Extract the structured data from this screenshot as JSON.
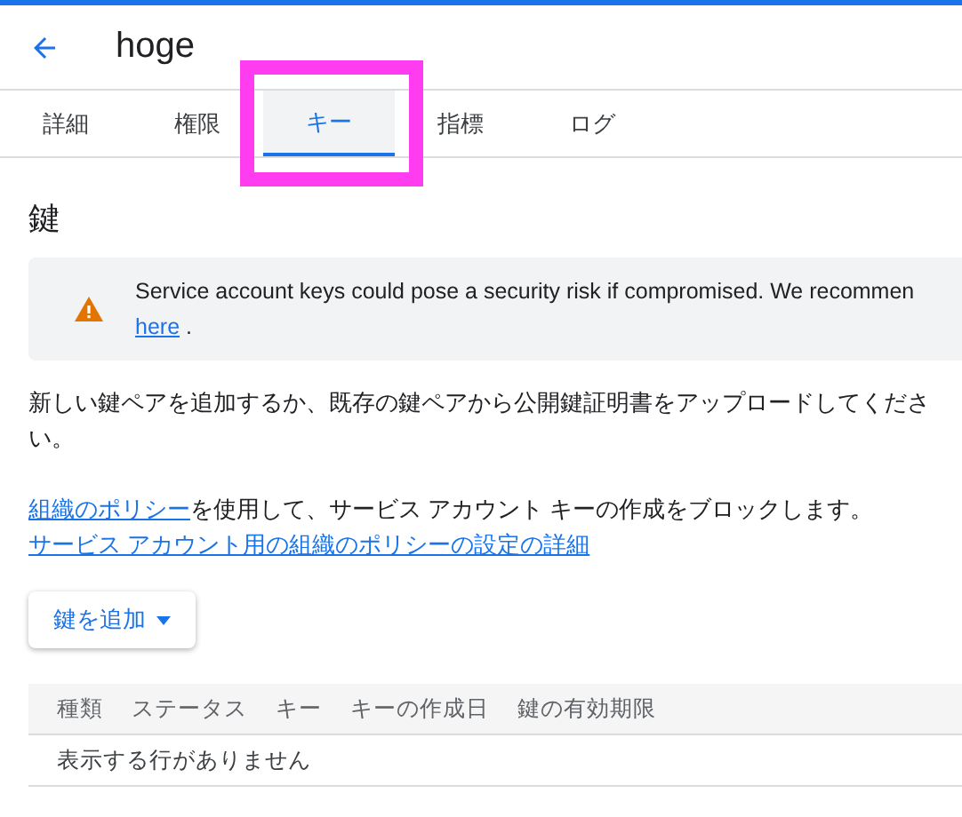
{
  "header": {
    "title": "hoge"
  },
  "tabs": [
    {
      "label": "詳細",
      "selected": false,
      "highlighted": false
    },
    {
      "label": "権限",
      "selected": false,
      "highlighted": false
    },
    {
      "label": "キー",
      "selected": true,
      "highlighted": true
    },
    {
      "label": "指標",
      "selected": false,
      "highlighted": false
    },
    {
      "label": "ログ",
      "selected": false,
      "highlighted": false
    }
  ],
  "section_title": "鍵",
  "warning": {
    "text": "Service account keys could pose a security risk if compromised. We recommen",
    "link": "here",
    "after": "."
  },
  "description": "新しい鍵ペアを追加するか、既存の鍵ペアから公開鍵証明書をアップロードしてください。",
  "policy": {
    "link": "組織のポリシー",
    "text": "を使用して、サービス アカウント キーの作成をブロックします。"
  },
  "details_link": "サービス アカウント用の組織のポリシーの設定の詳細",
  "add_button": "鍵を追加",
  "table": {
    "columns": [
      "種類",
      "ステータス",
      "キー",
      "キーの作成日",
      "鍵の有効期限"
    ],
    "empty": "表示する行がありません"
  }
}
